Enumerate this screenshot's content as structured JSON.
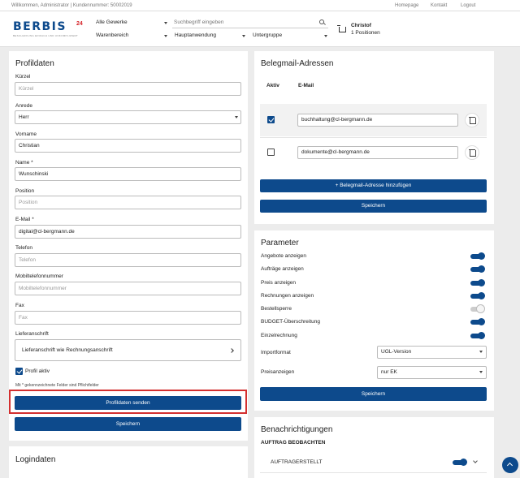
{
  "topbar": {
    "welcome": "Willkommen, Administrator | Kundennummer: 50002019",
    "links": [
      "Homepage",
      "Kontakt",
      "Logout"
    ]
  },
  "header": {
    "logo_text": "BERBIS",
    "logo_sup": "24",
    "logo_tagline": "BESCHAFFUNG EINFACH UND UNKOMPLIZIERT",
    "gewerke_select": "Alle Gewerke",
    "warenbereich_select": "Warenbereich",
    "search_placeholder": "Suchbegriff eingeben",
    "hauptanwendung_select": "Hauptanwendung",
    "untergruppe_select": "Untergruppe",
    "user_name": "Christof",
    "cart_count": "1 Positionen"
  },
  "profil": {
    "title": "Profildaten",
    "kuerzel_label": "Kürzel",
    "kuerzel_placeholder": "Kürzel",
    "anrede_label": "Anrede",
    "anrede_value": "Herr",
    "vorname_label": "Vorname",
    "vorname_value": "Christian",
    "name_label": "Name *",
    "name_value": "Wunschinski",
    "position_label": "Position",
    "position_placeholder": "Position",
    "email_label": "E-Mail *",
    "email_value": "digital@cl-bergmann.de",
    "telefon_label": "Telefon",
    "telefon_placeholder": "Telefon",
    "mobil_label": "Mobiltelefonnummer",
    "mobil_placeholder": "Mobiltelefonnummer",
    "fax_label": "Fax",
    "fax_placeholder": "Fax",
    "lieferanschrift_label": "Lieferanschrift",
    "lieferanschrift_value": "Lieferanschrift wie Rechnungsanschrift",
    "profil_aktiv_label": "Profil aktiv",
    "pflicht_note": "Mit * gekennzeichnete Felder sind Pflichtfelder",
    "senden_button": "Profildaten senden",
    "speichern_button": "Speichern"
  },
  "login": {
    "title": "Logindaten"
  },
  "belegmail": {
    "title": "Belegmail-Adressen",
    "col_aktiv": "Aktiv",
    "col_email": "E-Mail",
    "rows": [
      {
        "email": "buchhaltung@cl-bergmann.de",
        "active": true
      },
      {
        "email": "dokumente@cl-bergmann.de",
        "active": false
      }
    ],
    "add_button": "+ Belegmail-Adresse hinzufügen",
    "speichern_button": "Speichern"
  },
  "parameter": {
    "title": "Parameter",
    "toggles": [
      {
        "label": "Angebote anzeigen",
        "on": true
      },
      {
        "label": "Aufträge anzeigen",
        "on": true
      },
      {
        "label": "Preis anzeigen",
        "on": true
      },
      {
        "label": "Rechnungen anzeigen",
        "on": true
      },
      {
        "label": "Bestellsperre",
        "on": false
      },
      {
        "label": "BUDGET-Überschreitung",
        "on": true
      },
      {
        "label": "Einzelrechnung",
        "on": true
      }
    ],
    "importformat_label": "Importformat",
    "importformat_value": "UGL-Version",
    "preisanzeigen_label": "Preisanzeigen",
    "preisanzeigen_value": "nur EK",
    "speichern_button": "Speichern"
  },
  "benachrichtigungen": {
    "title": "Benachrichtigungen",
    "subtitle": "AUFTRAG BEOBACHTEN",
    "item_label": "AUFTRAGERSTELLT",
    "item_on": true
  }
}
